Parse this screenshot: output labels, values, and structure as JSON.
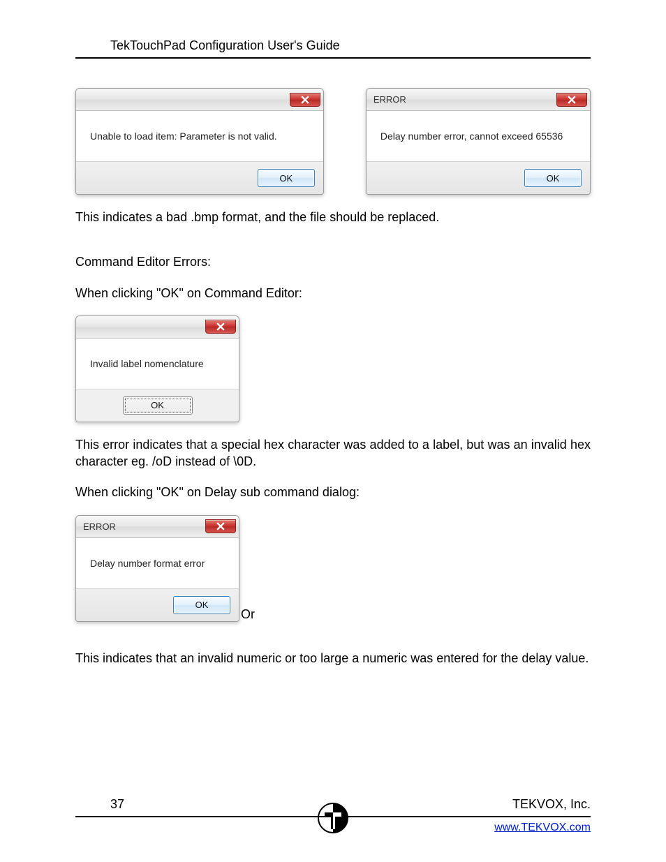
{
  "header": {
    "title": "TekTouchPad Configuration User's Guide"
  },
  "dialogs": {
    "d1": {
      "title": "",
      "message": "Unable to load item: Parameter is not valid.",
      "ok": "OK"
    },
    "d2": {
      "title": "ERROR",
      "message": "Delay number error, cannot exceed 65536",
      "ok": "OK"
    },
    "d3": {
      "title": "",
      "message": "Invalid label nomenclature",
      "ok": "OK"
    },
    "d4": {
      "title": "ERROR",
      "message": "Delay number format error",
      "ok": "OK"
    }
  },
  "body": {
    "p1": "This indicates a bad .bmp format, and the file should be replaced.",
    "p2": "Command Editor Errors:",
    "p3": "When clicking \"OK\" on Command Editor:",
    "p4": "This error indicates that a special hex character was added to a label, but was an invalid hex character eg. /oD instead of \\0D.",
    "p5": "When clicking \"OK\" on Delay sub command dialog:",
    "or": "Or",
    "p6": "This indicates that an invalid numeric or too large a numeric was entered for the delay value."
  },
  "footer": {
    "page_number": "37",
    "company": "TEKVOX, Inc.",
    "url": "www.TEKVOX.com"
  }
}
